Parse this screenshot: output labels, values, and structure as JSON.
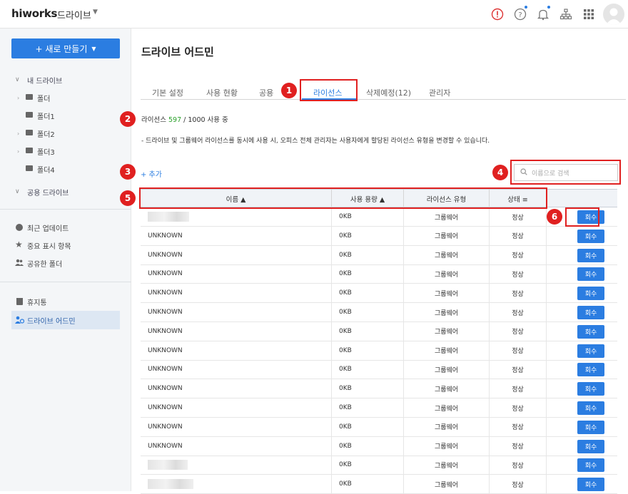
{
  "header": {
    "logo": "hiworks",
    "app_name": "드라이브",
    "icons": [
      "alert-icon",
      "help-icon",
      "bell-icon",
      "org-chart-icon",
      "apps-grid-icon",
      "avatar"
    ]
  },
  "sidebar": {
    "new_button": "+ 새로 만들기",
    "my_drive": "내 드라이브",
    "folders": [
      "폴더",
      "폴더1",
      "폴더2",
      "폴더3",
      "폴더4"
    ],
    "shared_drive": "공용 드라이브",
    "recent": "최근 업데이트",
    "starred": "중요 표시 항목",
    "shared_folder": "공유한 폴더",
    "trash": "휴지통",
    "admin": "드라이브 어드민"
  },
  "main": {
    "title": "드라이브 어드민",
    "tabs": [
      "기본 설정",
      "사용 현황",
      "공용 ",
      "라이선스",
      "삭제예정(12)",
      "관리자"
    ],
    "license_prefix": "라이선스 ",
    "license_used": "597",
    "license_suffix": " / 1000 사용 중",
    "notice": "- 드라이브 및 그룹웨어 라이선스를 동시에 사용 시, 오피스 전체 관리자는 사용자에게 할당된 라이선스 유형을 변경할 수 있습니다.",
    "add_link": "+ 추가",
    "search_placeholder": "이름으로 검색",
    "columns": [
      "이름 ▲",
      "사용 용량 ▲",
      "라이선스 유형",
      "상태 ≡"
    ],
    "rows": [
      {
        "name": "",
        "usage": "0KB",
        "type": "그룹웨어",
        "status": "정상",
        "action": "회수"
      },
      {
        "name": "UNKNOWN",
        "usage": "0KB",
        "type": "그룹웨어",
        "status": "정상",
        "action": "회수"
      },
      {
        "name": "UNKNOWN",
        "usage": "0KB",
        "type": "그룹웨어",
        "status": "정상",
        "action": "회수"
      },
      {
        "name": "UNKNOWN",
        "usage": "0KB",
        "type": "그룹웨어",
        "status": "정상",
        "action": "회수"
      },
      {
        "name": "UNKNOWN",
        "usage": "0KB",
        "type": "그룹웨어",
        "status": "정상",
        "action": "회수"
      },
      {
        "name": "UNKNOWN",
        "usage": "0KB",
        "type": "그룹웨어",
        "status": "정상",
        "action": "회수"
      },
      {
        "name": "UNKNOWN",
        "usage": "0KB",
        "type": "그룹웨어",
        "status": "정상",
        "action": "회수"
      },
      {
        "name": "UNKNOWN",
        "usage": "0KB",
        "type": "그룹웨어",
        "status": "정상",
        "action": "회수"
      },
      {
        "name": "UNKNOWN",
        "usage": "0KB",
        "type": "그룹웨어",
        "status": "정상",
        "action": "회수"
      },
      {
        "name": "UNKNOWN",
        "usage": "0KB",
        "type": "그룹웨어",
        "status": "정상",
        "action": "회수"
      },
      {
        "name": "UNKNOWN",
        "usage": "0KB",
        "type": "그룹웨어",
        "status": "정상",
        "action": "회수"
      },
      {
        "name": "UNKNOWN",
        "usage": "0KB",
        "type": "그룹웨어",
        "status": "정상",
        "action": "회수"
      },
      {
        "name": "UNKNOWN",
        "usage": "0KB",
        "type": "그룹웨어",
        "status": "정상",
        "action": "회수"
      },
      {
        "name": "",
        "usage": "0KB",
        "type": "그룹웨어",
        "status": "정상",
        "action": "회수"
      },
      {
        "name": "",
        "usage": "0KB",
        "type": "그룹웨어",
        "status": "정상",
        "action": "회수"
      }
    ]
  },
  "annotations": [
    "1",
    "2",
    "3",
    "4",
    "5",
    "6"
  ],
  "colors": {
    "accent": "#2b7de1",
    "annotation": "#e02020",
    "license_count": "#2aa02a"
  }
}
